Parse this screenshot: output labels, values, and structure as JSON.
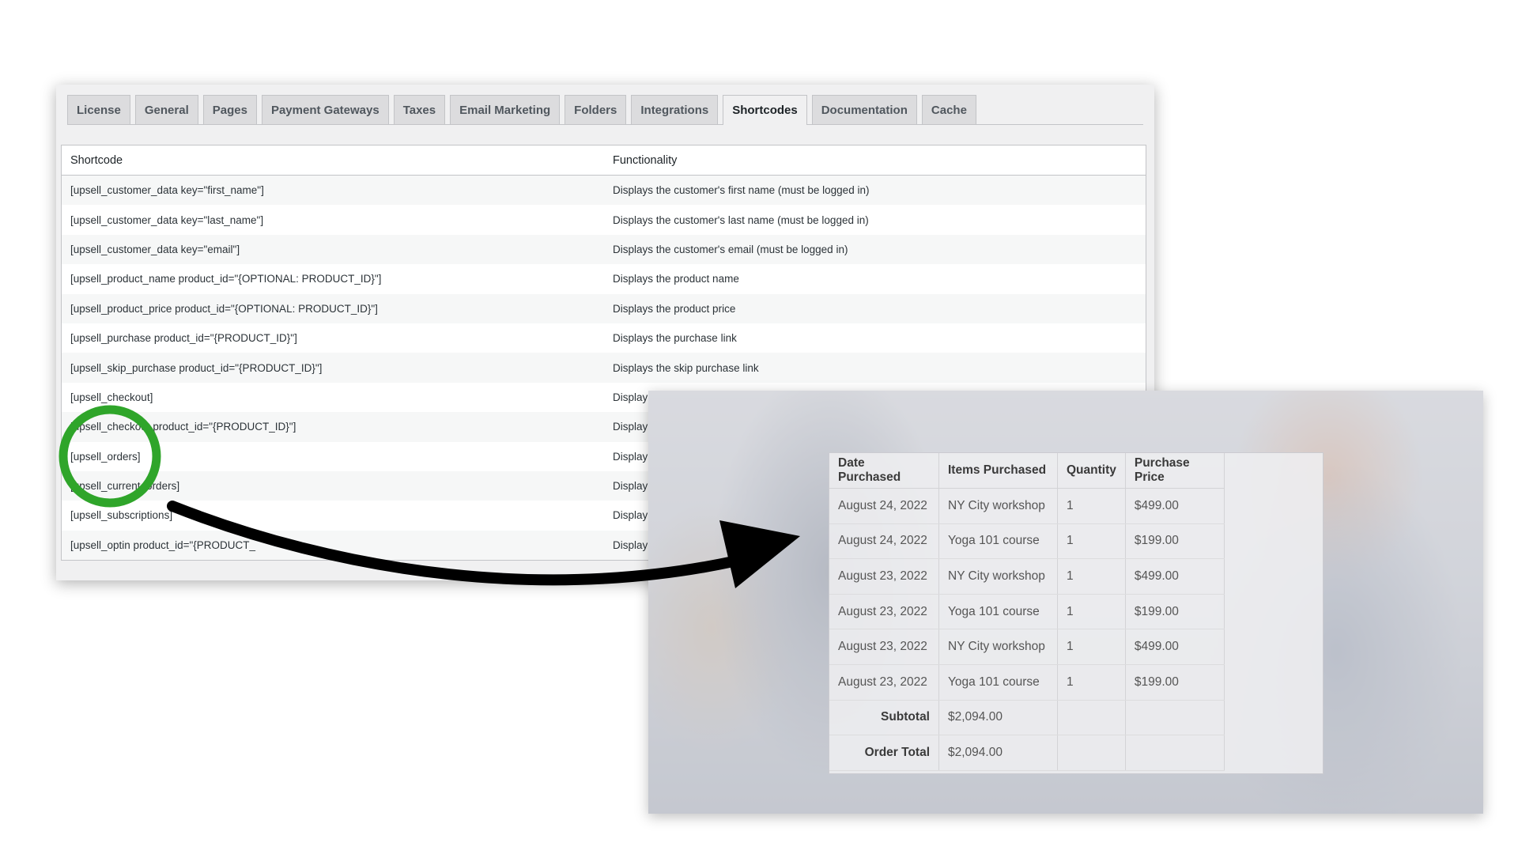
{
  "tabs": [
    {
      "label": "License"
    },
    {
      "label": "General"
    },
    {
      "label": "Pages"
    },
    {
      "label": "Payment Gateways"
    },
    {
      "label": "Taxes"
    },
    {
      "label": "Email Marketing"
    },
    {
      "label": "Folders"
    },
    {
      "label": "Integrations"
    },
    {
      "label": "Shortcodes",
      "active": true
    },
    {
      "label": "Documentation"
    },
    {
      "label": "Cache"
    }
  ],
  "shortcodes_table": {
    "headers": [
      "Shortcode",
      "Functionality"
    ],
    "rows": [
      {
        "shortcode": "[upsell_customer_data key=\"first_name\"]",
        "functionality": "Displays the customer's first name (must be logged in)"
      },
      {
        "shortcode": "[upsell_customer_data key=\"last_name\"]",
        "functionality": "Displays the customer's last name (must be logged in)"
      },
      {
        "shortcode": "[upsell_customer_data key=\"email\"]",
        "functionality": "Displays the customer's email (must be logged in)"
      },
      {
        "shortcode": "[upsell_product_name product_id=\"{OPTIONAL: PRODUCT_ID}\"]",
        "functionality": "Displays the product name"
      },
      {
        "shortcode": "[upsell_product_price product_id=\"{OPTIONAL: PRODUCT_ID}\"]",
        "functionality": "Displays the product price"
      },
      {
        "shortcode": "[upsell_purchase product_id=\"{PRODUCT_ID}\"]",
        "functionality": "Displays the purchase link"
      },
      {
        "shortcode": "[upsell_skip_purchase product_id=\"{PRODUCT_ID}\"]",
        "functionality": "Displays the skip purchase link"
      },
      {
        "shortcode": "[upsell_checkout]",
        "functionality": "Display"
      },
      {
        "shortcode": "[upsell_checkout product_id=\"{PRODUCT_ID}\"]",
        "functionality": "Display"
      },
      {
        "shortcode": "[upsell_orders]",
        "functionality": "Display"
      },
      {
        "shortcode": "[upsell_current_orders]",
        "functionality": "Display"
      },
      {
        "shortcode": "[upsell_subscriptions]",
        "functionality": "Display"
      },
      {
        "shortcode": "[upsell_optin product_id=\"{PRODUCT_",
        "functionality": "Display"
      }
    ]
  },
  "orders_table": {
    "headers": [
      "Date Purchased",
      "Items Purchased",
      "Quantity",
      "Purchase Price"
    ],
    "rows": [
      {
        "date": "August 24, 2022",
        "item": "NY City workshop",
        "qty": "1",
        "price": "$499.00"
      },
      {
        "date": "August 24, 2022",
        "item": "Yoga 101 course",
        "qty": "1",
        "price": "$199.00"
      },
      {
        "date": "August 23, 2022",
        "item": "NY City workshop",
        "qty": "1",
        "price": "$499.00"
      },
      {
        "date": "August 23, 2022",
        "item": "Yoga 101 course",
        "qty": "1",
        "price": "$199.00"
      },
      {
        "date": "August 23, 2022",
        "item": "NY City workshop",
        "qty": "1",
        "price": "$499.00"
      },
      {
        "date": "August 23, 2022",
        "item": "Yoga 101 course",
        "qty": "1",
        "price": "$199.00"
      }
    ],
    "subtotal_label": "Subtotal",
    "subtotal_value": "$2,094.00",
    "order_total_label": "Order Total",
    "order_total_value": "$2,094.00"
  },
  "annotation": {
    "highlight_color": "#2fa52a",
    "arrow_color": "#000000",
    "highlight_icon": "green-circle",
    "arrow_icon": "curved-arrow"
  }
}
